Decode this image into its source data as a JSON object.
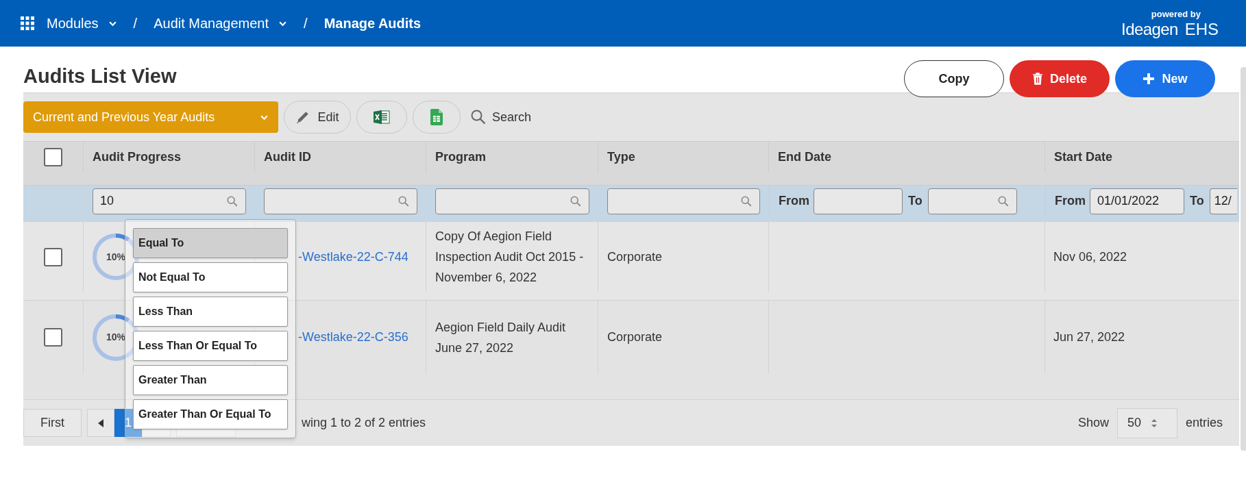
{
  "header": {
    "breadcrumbs": [
      {
        "kind": "link",
        "label": "Modules",
        "dropdown": true
      },
      {
        "kind": "separator",
        "label": "/"
      },
      {
        "kind": "link",
        "label": "Audit Management",
        "dropdown": true
      },
      {
        "kind": "separator",
        "label": "/"
      },
      {
        "kind": "current",
        "label": "Manage Audits",
        "dropdown": false
      }
    ],
    "brand": {
      "tagline": "powered by",
      "name": "Ideagen",
      "product": "EHS"
    }
  },
  "page_title": "Audits List View",
  "actions": [
    {
      "kind": "outline",
      "label": "Copy"
    },
    {
      "kind": "danger",
      "label": "Delete"
    },
    {
      "kind": "primary",
      "label": "New"
    }
  ],
  "toolbar": {
    "view_select": "Current and Previous Year Audits",
    "edit": "Edit",
    "search": "Search"
  },
  "table": {
    "select_all": {
      "checked": false
    },
    "columns": [
      "Audit Progress",
      "Audit ID",
      "Program",
      "Type",
      "End Date",
      "Start Date"
    ],
    "filters": {
      "audit_progress": "10",
      "end_date": {
        "from_label": "From",
        "to_label": "To"
      },
      "start_date": {
        "from_label": "From",
        "from_value": "01/01/2022",
        "to_label": "To",
        "to_value": "12/"
      }
    },
    "rows": [
      {
        "checked": false,
        "progress": "10%",
        "level": 0.1,
        "audit_id": "-Westlake-22-C-744",
        "program": "Copy Of Aegion Field Inspection Audit Oct 2015 - November 6, 2022",
        "type": "Corporate",
        "start_date": "Nov 06, 2022"
      },
      {
        "checked": false,
        "progress": "10%",
        "level": 0.1,
        "audit_id": "-Westlake-22-C-356",
        "program": "Aegion Field Daily Audit June 27, 2022",
        "type": "Corporate",
        "start_date": "Jun 27, 2022"
      }
    ]
  },
  "operator_menu": {
    "options": [
      {
        "label": "Equal To",
        "selected": true
      },
      {
        "label": "Not Equal To",
        "selected": false
      },
      {
        "label": "Less Than",
        "selected": false
      },
      {
        "label": "Less Than Or Equal To",
        "selected": false
      },
      {
        "label": "Greater Than",
        "selected": false
      },
      {
        "label": "Greater Than Or Equal To",
        "selected": false
      }
    ]
  },
  "pagination": {
    "first": "First",
    "pages": [
      {
        "label": "1",
        "selected": true
      }
    ],
    "summary": "wing 1 to 2 of 2 entries",
    "show_label": "Show",
    "page_size": "50",
    "entries_label": "entries"
  }
}
